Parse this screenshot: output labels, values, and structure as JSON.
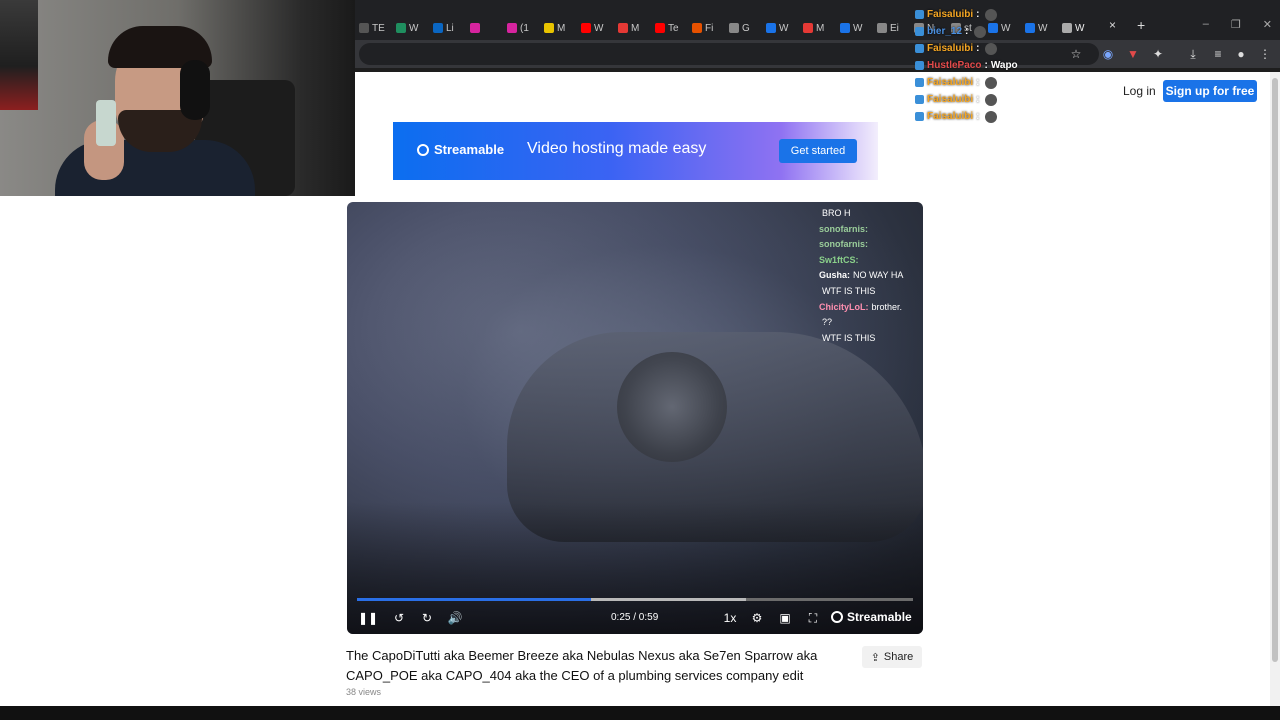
{
  "browser": {
    "tabs": [
      {
        "label": "TE",
        "color": "#555555"
      },
      {
        "label": "W",
        "color": "#1f8f5f"
      },
      {
        "label": "Li",
        "color": "#0a66c2"
      },
      {
        "label": "",
        "color": "#d6249f"
      },
      {
        "label": "(1",
        "color": "#d6249f"
      },
      {
        "label": "M",
        "color": "#e9c400"
      },
      {
        "label": "W",
        "color": "#ff0000"
      },
      {
        "label": "M",
        "color": "#e53935"
      },
      {
        "label": "Te",
        "color": "#ff0000"
      },
      {
        "label": "Fi",
        "color": "#e65100"
      },
      {
        "label": "G",
        "color": "#888888"
      },
      {
        "label": "W",
        "color": "#1a73e8"
      },
      {
        "label": "M",
        "color": "#e53935"
      },
      {
        "label": "W",
        "color": "#1a73e8"
      },
      {
        "label": "Ei",
        "color": "#888888"
      },
      {
        "label": "N",
        "color": "#888888"
      },
      {
        "label": "st",
        "color": "#888888"
      },
      {
        "label": "W",
        "color": "#1a73e8"
      },
      {
        "label": "W",
        "color": "#1a73e8"
      },
      {
        "label": "W",
        "color": "#aaaaaa"
      }
    ],
    "new_tab": "+",
    "close_tab": "×"
  },
  "header": {
    "login": "Log in",
    "signup": "Sign up for free"
  },
  "banner": {
    "brand": "Streamable",
    "tagline": "Video hosting made easy",
    "cta": "Get started"
  },
  "video": {
    "time": "0:25 / 0:59",
    "speed": "1x",
    "brand": "Streamable",
    "progress_fraction": 0.42,
    "buffer_fraction": 0.7,
    "embedded_chat": [
      {
        "user": "",
        "msg": "BRO H",
        "color": "#bbbbbb"
      },
      {
        "user": "sonofarnis:",
        "msg": "",
        "color": "#9acd9a"
      },
      {
        "user": "sonofarnis:",
        "msg": "",
        "color": "#9acd9a"
      },
      {
        "user": "Sw1ftCS:",
        "msg": "",
        "color": "#8ad08a"
      },
      {
        "user": "Gusha:",
        "msg": "NO WAY HA",
        "color": "#ffffff"
      },
      {
        "user": "",
        "msg": "WTF IS THIS",
        "color": "#ffffff"
      },
      {
        "user": "ChicityLoL:",
        "msg": "brother.",
        "color": "#ff8fb0"
      },
      {
        "user": "",
        "msg": "??",
        "color": "#ffffff"
      },
      {
        "user": "",
        "msg": "WTF IS THIS",
        "color": "#ffffff"
      }
    ]
  },
  "post": {
    "title": "The CapoDiTutti aka Beemer Breeze aka Nebulas Nexus aka Se7en Sparrow aka CAPO_POE aka CAPO_404 aka the CEO of a plumbing services company edit",
    "views": "38 views",
    "share": "Share"
  },
  "stream_chat": [
    {
      "user": "Faisaluibi",
      "msg": "",
      "color": "#f5a623"
    },
    {
      "user": "bier_12",
      "msg": "",
      "color": "#4a90e2"
    },
    {
      "user": "Faisaluibi",
      "msg": "",
      "color": "#f5a623"
    },
    {
      "user": "HustlePaco",
      "msg": "Wapo",
      "color": "#e24a4a"
    },
    {
      "user": "Faisaluibi",
      "msg": "",
      "color": "#f5a623"
    },
    {
      "user": "Faisaluibi",
      "msg": "",
      "color": "#f5a623"
    },
    {
      "user": "Faisaluibi",
      "msg": "",
      "color": "#f5a623"
    }
  ]
}
